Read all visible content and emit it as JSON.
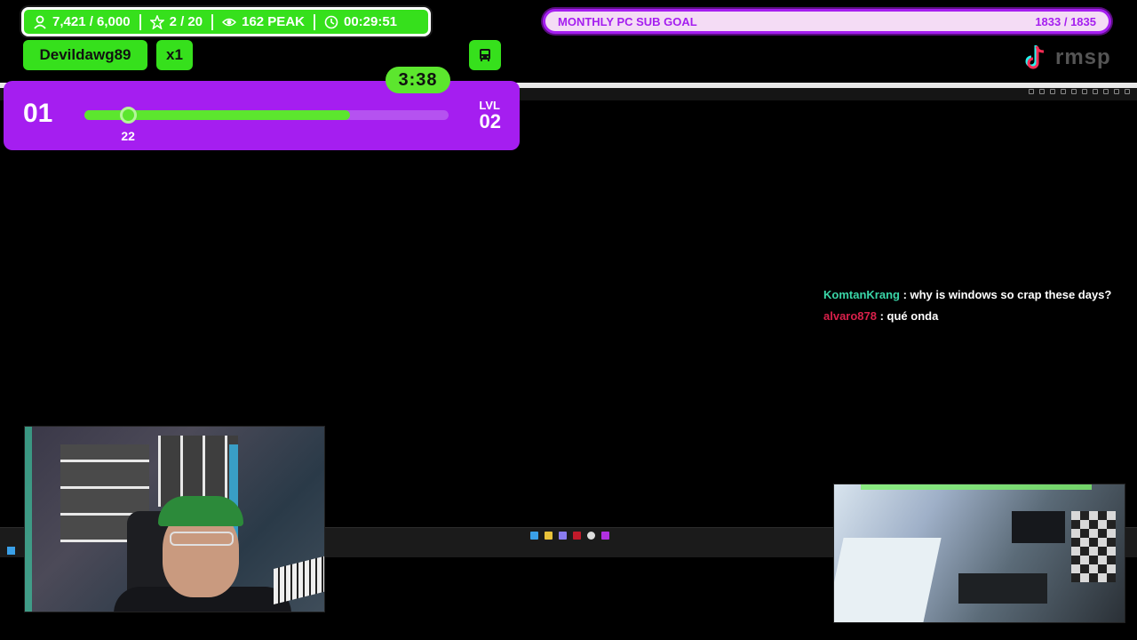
{
  "stats": {
    "followers": "7,421 / 6,000",
    "stars": "2 / 20",
    "peak": "162 PEAK",
    "uptime": "00:29:51"
  },
  "event": {
    "username": "Devildawg89",
    "multiplier": "x1",
    "bus_icon": "bus-icon"
  },
  "level": {
    "current": "01",
    "next_label": "LVL",
    "next": "02",
    "progress_value": "22",
    "fill_fraction": 0.73,
    "knob_fraction": 0.12,
    "timer": "3:38"
  },
  "goal": {
    "title": "MONTHLY PC SUB GOAL",
    "value": "1833 / 1835"
  },
  "logo": {
    "text": "rmsp",
    "icon": "tiktok-icon"
  },
  "chat": [
    {
      "user": "KomtanKrang",
      "message": " : why is windows so crap these days?",
      "color": "#3ad6a8"
    },
    {
      "user": "alvaro878",
      "message": " : qué onda",
      "color": "#d8204a"
    }
  ],
  "colors": {
    "accent_green": "#36e01c",
    "accent_purple": "#a51ef0"
  },
  "taskbar": {
    "icons": [
      "windows-icon",
      "files-icon",
      "folder-icon",
      "app-icon",
      "record-icon",
      "settings-icon",
      "media-icon"
    ]
  }
}
